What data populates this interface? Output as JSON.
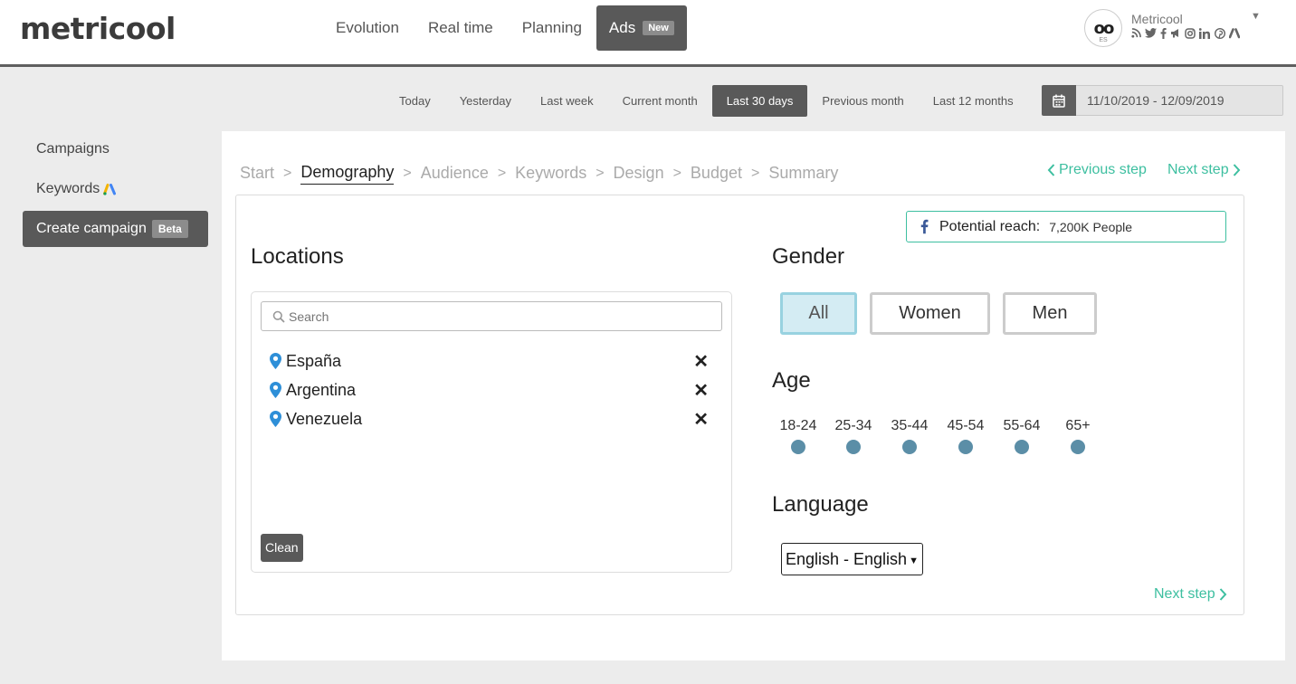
{
  "header": {
    "logo": "metricool",
    "nav": [
      {
        "label": "Evolution"
      },
      {
        "label": "Real time"
      },
      {
        "label": "Planning"
      },
      {
        "label": "Ads",
        "badge": "New"
      }
    ],
    "profile": {
      "name": "Metricool",
      "avatar_sub": "ES",
      "social_icons": [
        "rss-icon",
        "twitter-icon",
        "facebook-icon",
        "megaphone-icon",
        "instagram-icon",
        "linkedin-icon",
        "pinterest-icon",
        "google-ads-icon"
      ]
    }
  },
  "date_filters": {
    "options": [
      "Today",
      "Yesterday",
      "Last week",
      "Current month",
      "Last 30 days",
      "Previous month",
      "Last 12 months"
    ],
    "active": "Last 30 days",
    "range": "11/10/2019 - 12/09/2019"
  },
  "sidebar": {
    "items": [
      {
        "label": "Campaigns"
      },
      {
        "label": "Keywords"
      },
      {
        "label": "Create campaign",
        "badge": "Beta"
      }
    ]
  },
  "steps": {
    "items": [
      "Start",
      "Demography",
      "Audience",
      "Keywords",
      "Design",
      "Budget",
      "Summary"
    ],
    "active": "Demography",
    "previous_label": "Previous step",
    "next_label": "Next step"
  },
  "reach": {
    "label": "Potential reach:",
    "value": "7,200K People"
  },
  "locations": {
    "title": "Locations",
    "search_placeholder": "Search",
    "items": [
      "España",
      "Argentina",
      "Venezuela"
    ],
    "clean_label": "Clean"
  },
  "gender": {
    "title": "Gender",
    "options": [
      "All",
      "Women",
      "Men"
    ],
    "selected": "All"
  },
  "age": {
    "title": "Age",
    "ranges": [
      "18-24",
      "25-34",
      "35-44",
      "45-54",
      "55-64",
      "65+"
    ]
  },
  "language": {
    "title": "Language",
    "selected": "English - English"
  },
  "colors": {
    "accent": "#3dbfa0",
    "dark": "#595959",
    "age_dot": "#5b8ea7",
    "gender_active_bg": "#d4ecf3",
    "pin": "#2e8fd8"
  }
}
